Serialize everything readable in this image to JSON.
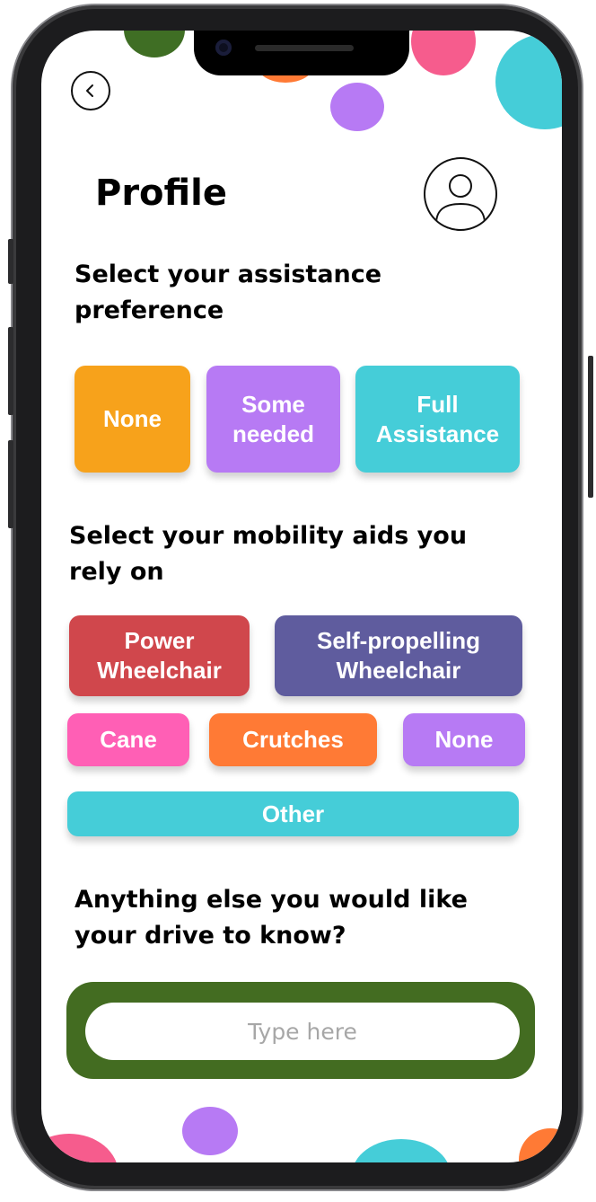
{
  "header": {
    "title": "Profile"
  },
  "assistance": {
    "heading_line1": "Select your assistance",
    "heading_line2": "preference",
    "options": [
      {
        "line1": "None",
        "line2": ""
      },
      {
        "line1": "Some",
        "line2": "needed"
      },
      {
        "line1": "Full",
        "line2": "Assistance"
      }
    ]
  },
  "mobility": {
    "heading_line1": "Select your mobility aids you",
    "heading_line2": "rely on",
    "options": [
      {
        "line1": "Power",
        "line2": "Wheelchair"
      },
      {
        "line1": "Self-propelling",
        "line2": "Wheelchair"
      },
      {
        "line1": "Cane",
        "line2": ""
      },
      {
        "line1": "Crutches",
        "line2": ""
      },
      {
        "line1": "None",
        "line2": ""
      },
      {
        "line1": "Other",
        "line2": ""
      }
    ]
  },
  "notes": {
    "heading_line1": "Anything else you would like",
    "heading_line2": "your drive to know?",
    "placeholder": "Type here"
  },
  "colors": {
    "orange": "#f7a21b",
    "purple": "#b77af4",
    "teal": "#45cdd8",
    "red": "#d0474c",
    "indigo": "#5f5c9e",
    "pink": "#ff5fb5",
    "coral_orange": "#ff7a35",
    "green": "#436c21",
    "blob_pink": "#f65c8d",
    "blob_green": "#3f6e24"
  },
  "icons": {
    "back": "chevron-left-icon",
    "avatar": "user-avatar-icon"
  }
}
